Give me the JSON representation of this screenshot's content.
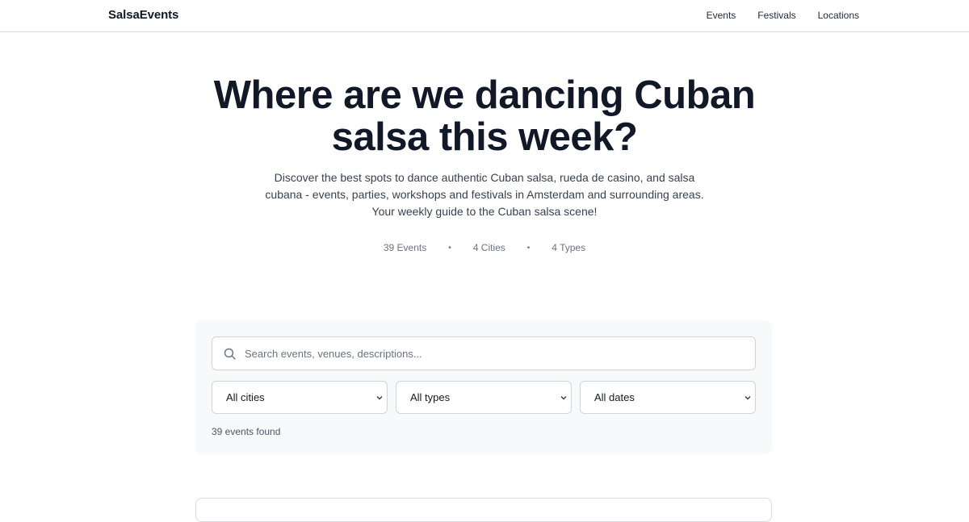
{
  "nav": {
    "brand": "SalsaEvents",
    "links": [
      "Events",
      "Festivals",
      "Locations"
    ]
  },
  "hero": {
    "title_line1": "Where are we dancing Cuban",
    "title_line2": "salsa this week?",
    "desc_line1": "Discover the best spots to dance authentic Cuban salsa, rueda de casino, and salsa",
    "desc_line2": "cubana - events, parties, workshops and festivals in Amsterdam and surrounding areas.",
    "desc_line3": "Your weekly guide to the Cuban salsa scene!"
  },
  "stats": {
    "events": "39 Events",
    "cities": "4 Cities",
    "types": "4 Types",
    "separator": "•"
  },
  "filters": {
    "search_placeholder": "Search events, venues, descriptions...",
    "search_value": "",
    "city": "All cities",
    "type": "All types",
    "date": "All dates",
    "results": "39 events found"
  },
  "icons": {
    "search": "search-icon",
    "chevron": "chevron-down-icon"
  },
  "colors": {
    "text_dark": "#111827",
    "text_muted": "#6b7280",
    "card_bg": "#f8f9fb",
    "border": "#cfd3da"
  }
}
